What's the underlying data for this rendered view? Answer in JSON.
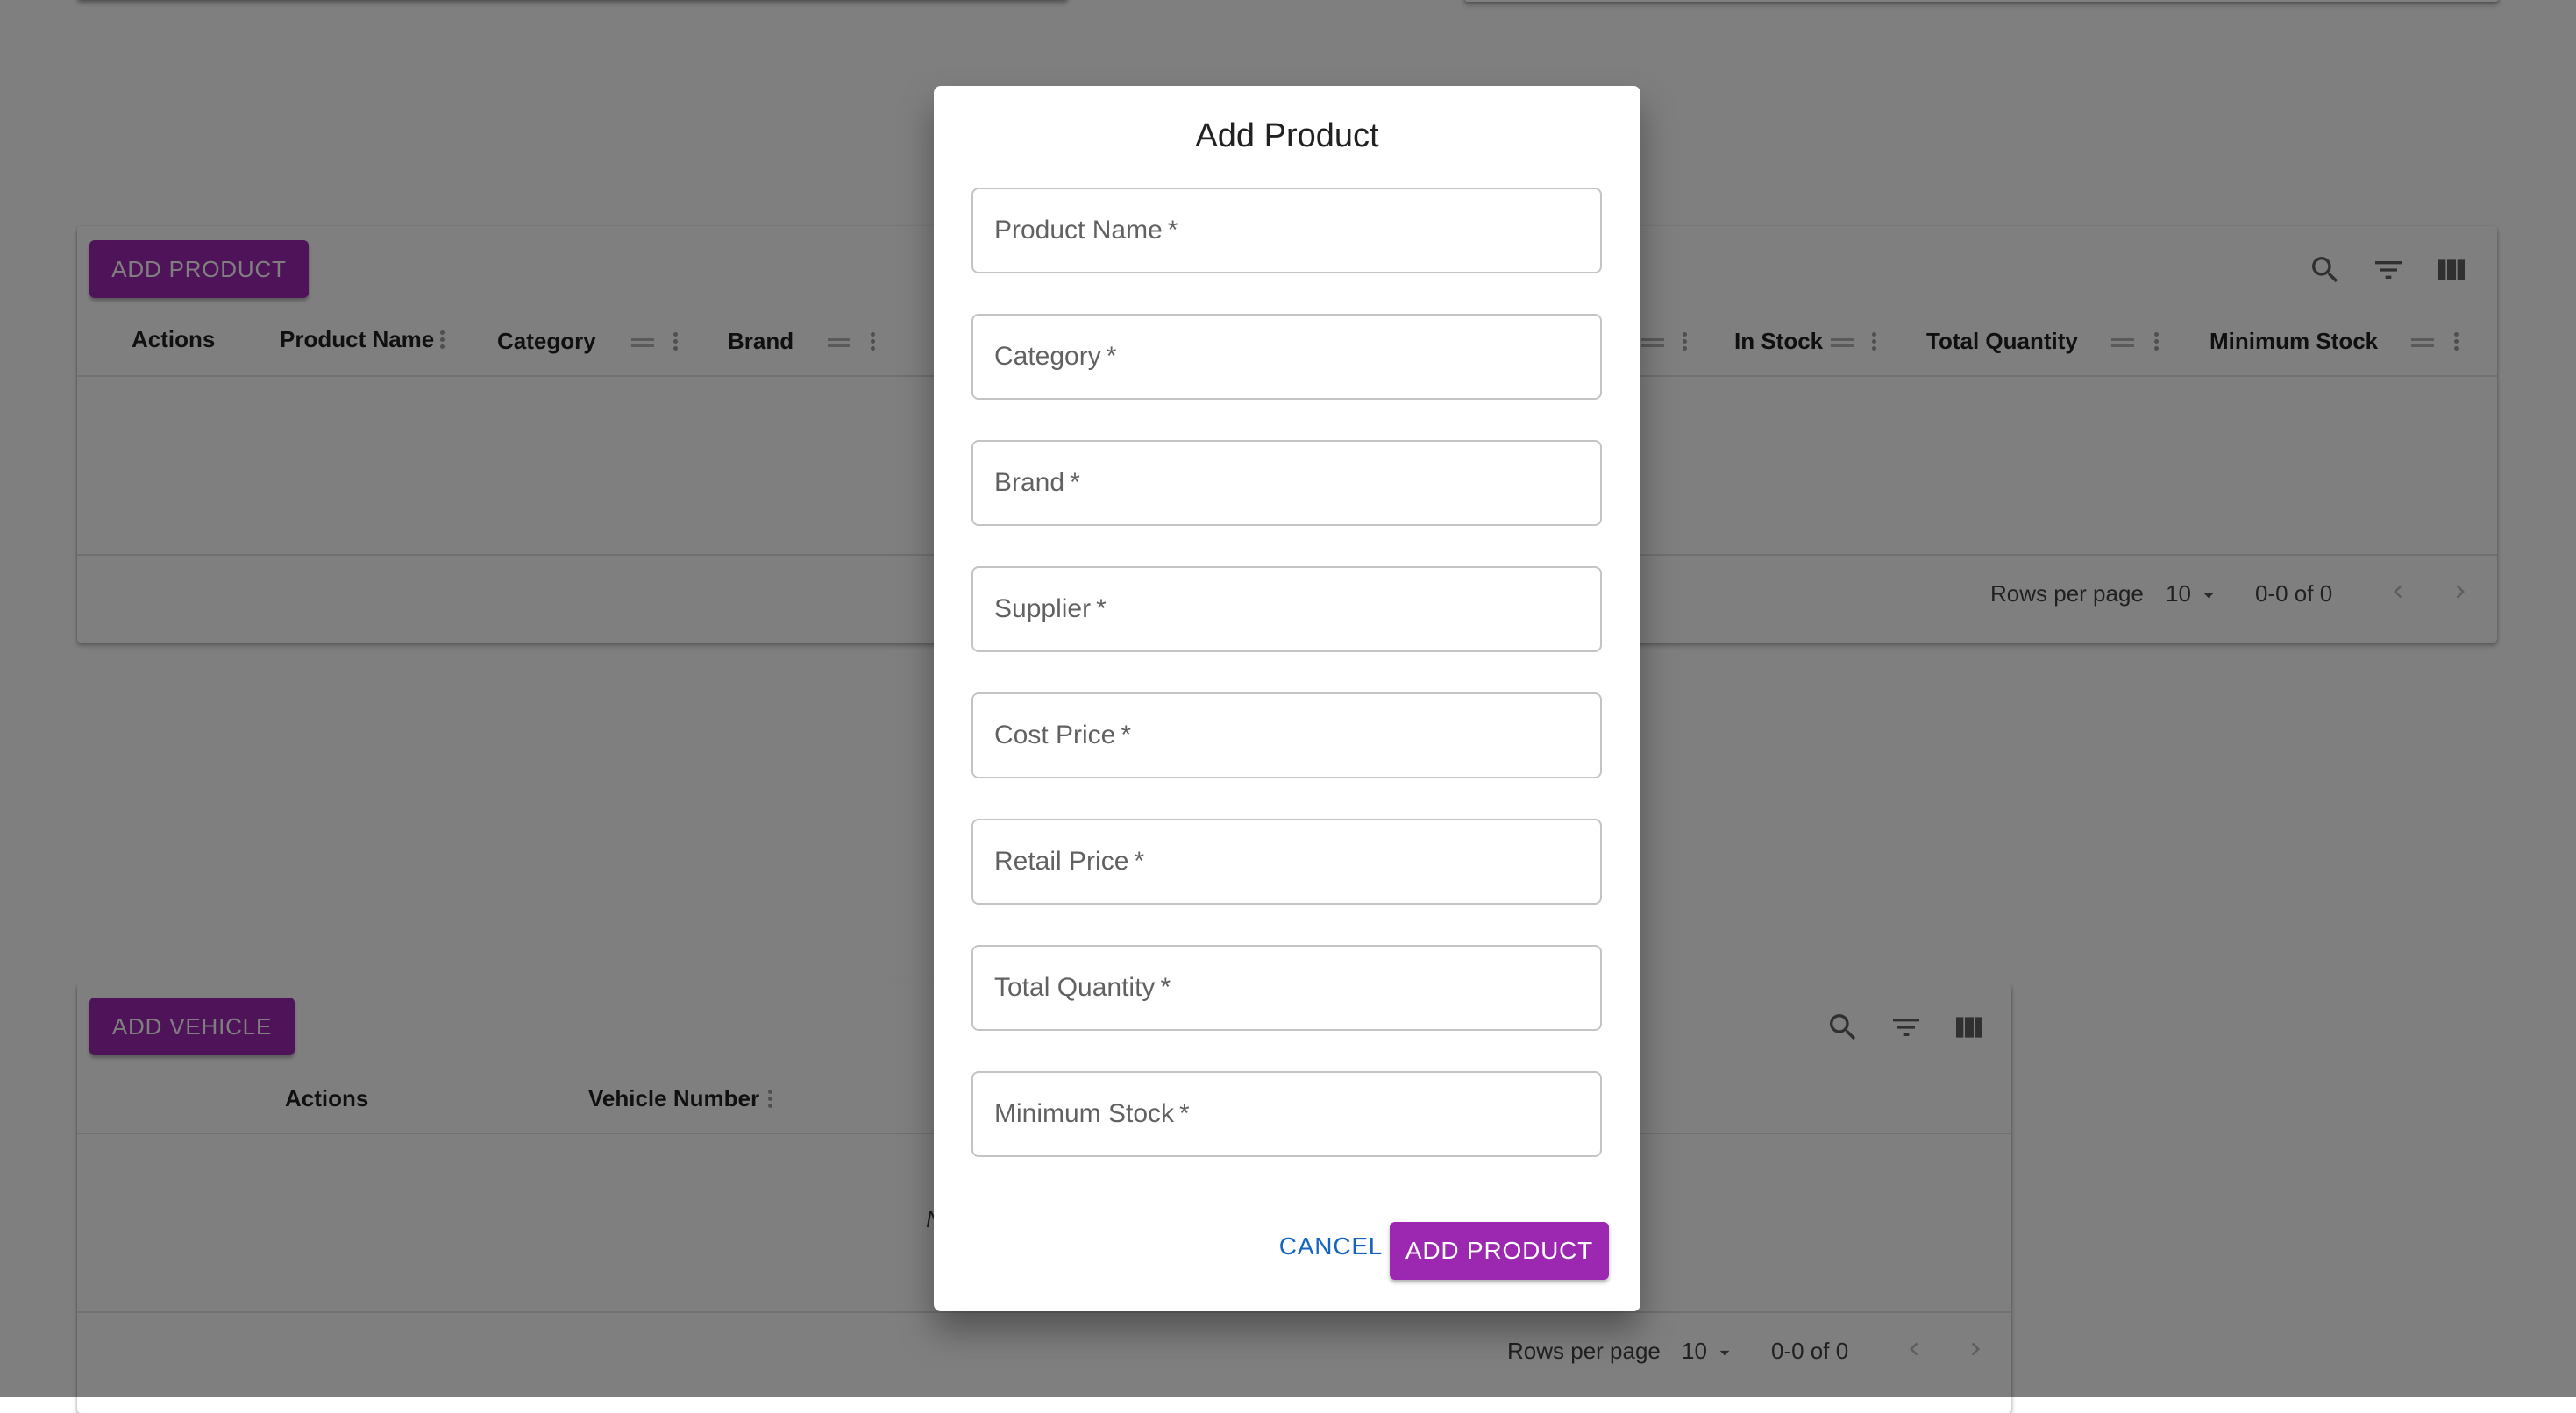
{
  "products_table": {
    "add_button": "ADD PRODUCT",
    "columns": [
      "Actions",
      "Product Name",
      "Category",
      "Brand",
      "In Stock",
      "Total Quantity",
      "Minimum Stock"
    ],
    "rows_per_page_label": "Rows per page",
    "rows_per_page_value": "10",
    "range": "0-0 of 0"
  },
  "vehicles_table": {
    "add_button": "ADD VEHICLE",
    "columns": [
      "Actions",
      "Vehicle Number"
    ],
    "rows_per_page_label": "Rows per page",
    "rows_per_page_value": "10",
    "range": "0-0 of 0",
    "partial_text": "N"
  },
  "dialog": {
    "title": "Add Product",
    "fields": [
      {
        "label": "Product Name",
        "required": "*"
      },
      {
        "label": "Category",
        "required": "*"
      },
      {
        "label": "Brand",
        "required": "*"
      },
      {
        "label": "Supplier",
        "required": "*"
      },
      {
        "label": "Cost Price",
        "required": "*"
      },
      {
        "label": "Retail Price",
        "required": "*"
      },
      {
        "label": "Total Quantity",
        "required": "*"
      },
      {
        "label": "Minimum Stock",
        "required": "*"
      }
    ],
    "cancel_label": "CANCEL",
    "submit_label": "ADD PRODUCT"
  },
  "colors": {
    "primary": "#9c27b0",
    "link": "#1565c0",
    "backdrop": "rgba(0,0,0,0.5)"
  },
  "icons": [
    "search-icon",
    "filter-icon",
    "view-column-icon",
    "dropdown-arrow-icon",
    "chevron-left-icon",
    "chevron-right-icon"
  ]
}
